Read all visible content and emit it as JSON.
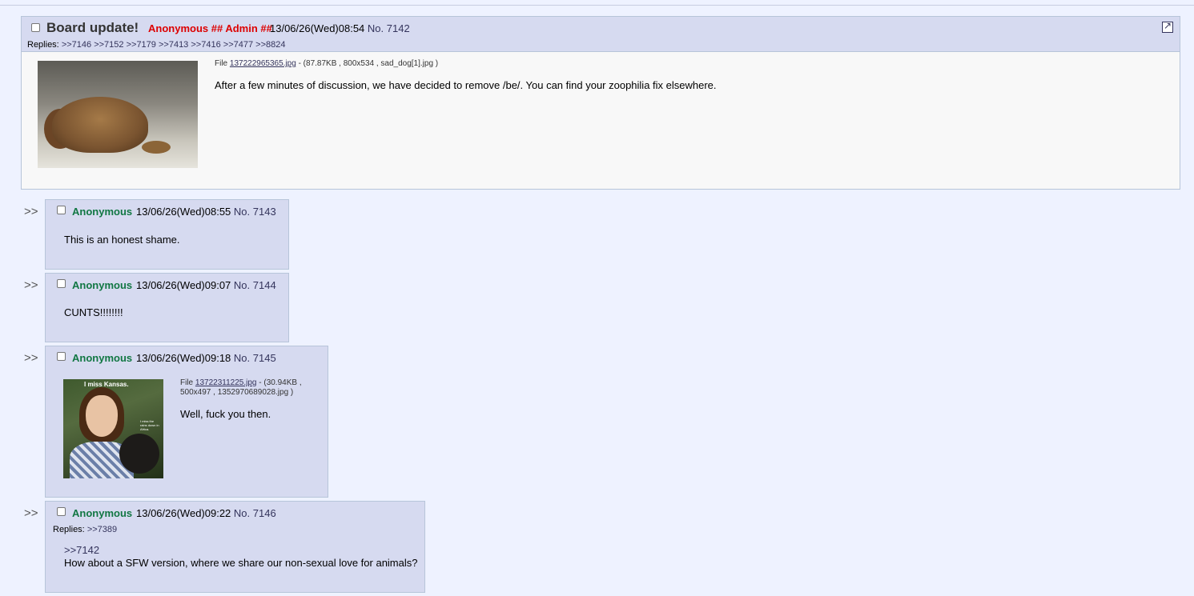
{
  "op": {
    "subject": "Board update!",
    "name": "Anonymous ## Admin ##",
    "datetime": "13/06/26(Wed)08:54",
    "number": "No. 7142",
    "replies_label": "Replies:",
    "replies": [
      ">>7146",
      ">>7152",
      ">>7179",
      ">>7413",
      ">>7416",
      ">>7477",
      ">>8824"
    ],
    "file_label": "File",
    "file_name": "137222965365.jpg",
    "file_meta": "- (87.87KB , 800x534 , sad_dog[1].jpg )",
    "message": "After a few minutes of discussion, we have decided to remove /be/. You can find your zoophilia fix elsewhere."
  },
  "reply_arrow": ">>",
  "posts": [
    {
      "name": "Anonymous",
      "datetime": "13/06/26(Wed)08:55",
      "number": "No. 7143",
      "message": "This is an honest shame."
    },
    {
      "name": "Anonymous",
      "datetime": "13/06/26(Wed)09:07",
      "number": "No. 7144",
      "message": "CUNTS!!!!!!!!"
    },
    {
      "name": "Anonymous",
      "datetime": "13/06/26(Wed)09:18",
      "number": "No. 7145",
      "file_label": "File",
      "file_name": "13722311225.jpg",
      "file_meta_1": "- (30.94KB ,",
      "file_meta_2": "500x497 , 1352970689028.jpg )",
      "image_caption_top": "I miss Kansas.",
      "image_caption_side": "I miss the rains down in Africa.",
      "message": "Well, fuck you then."
    },
    {
      "name": "Anonymous",
      "datetime": "13/06/26(Wed)09:22",
      "number": "No. 7146",
      "replies_label": "Replies:",
      "replies": [
        ">>7389"
      ],
      "quote": ">>7142",
      "message": "How about a SFW version, where we share our non-sexual love for animals?"
    }
  ]
}
